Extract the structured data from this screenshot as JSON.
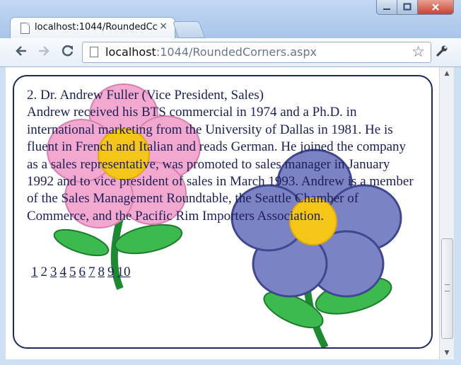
{
  "browser": {
    "tab_title": "localhost:1044/RoundedCc",
    "tab_close": "×",
    "url_host": "localhost",
    "url_rest": ":1044/RoundedCorners.aspx"
  },
  "icons": {
    "back": "back-arrow-icon",
    "forward": "forward-arrow-icon",
    "reload": "reload-icon",
    "star": "star-icon",
    "wrench": "wrench-icon"
  },
  "content": {
    "heading": "2. Dr. Andrew Fuller (Vice President, Sales)",
    "bio": "Andrew received his BTS commercial in 1974 and a Ph.D. in international marketing from the University of Dallas in 1981. He is fluent in French and Italian and reads German. He joined the company as a sales representative, was promoted to sales manager in January 1992 and to vice president of sales in March 1993. Andrew is a member of the Sales Management Roundtable, the Seattle Chamber of Commerce, and the Pacific Rim Importers Association."
  },
  "pager": {
    "p1": "1",
    "p2": "2",
    "p3": "3",
    "p4": "4",
    "p5": "5",
    "p6": "6",
    "p7": "7",
    "p8": "8",
    "p9": "9",
    "p10": "10"
  },
  "colors": {
    "text": "#1a1f55",
    "pink_flower": "#f3a8cf",
    "blue_flower": "#7b83c4",
    "flower_center": "#f5c518",
    "leaf": "#3dba4e"
  }
}
